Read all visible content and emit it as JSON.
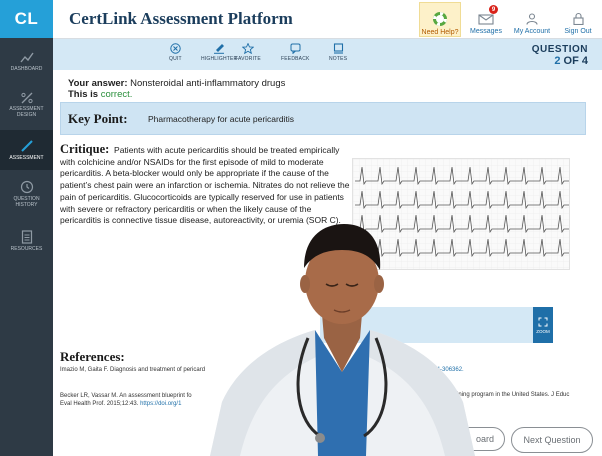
{
  "app": {
    "logo": "CL",
    "title": "CertLink Assessment Platform"
  },
  "header": {
    "help_label": "Need Help?",
    "messages_label": "Messages",
    "messages_count": "9",
    "account_label": "My Account",
    "signout_label": "Sign Out"
  },
  "sidebar": {
    "items": [
      {
        "label": "DASHBOARD",
        "icon": "line-chart-icon"
      },
      {
        "label": "ASSESSMENT DESIGN",
        "icon": "percent-icon"
      },
      {
        "label": "ASSESSMENT",
        "icon": "pencil-icon",
        "active": true
      },
      {
        "label": "QUESTION HISTORY",
        "icon": "history-icon"
      },
      {
        "label": "RESOURCES",
        "icon": "document-icon"
      }
    ]
  },
  "toolbar": {
    "items": [
      {
        "label": "QUIT",
        "icon": "close-circle-icon"
      },
      {
        "label": "HIGHLIGHTER",
        "icon": "highlighter-icon"
      },
      {
        "label": "FAVORITE",
        "icon": "star-icon"
      },
      {
        "label": "FEEDBACK",
        "icon": "chat-icon"
      },
      {
        "label": "NOTES",
        "icon": "notes-icon"
      }
    ],
    "question_word": "QUESTION",
    "question_current": "2",
    "question_of": "OF 4"
  },
  "answer": {
    "prefix": "Your answer:",
    "value": "Nonsteroidal anti-inflammatory drugs",
    "status_prefix": "This is",
    "status": "correct."
  },
  "keypoint": {
    "label": "Key Point:",
    "text": "Pharmacotherapy for acute pericarditis"
  },
  "critique": {
    "label": "Critique:",
    "text": "Patients with acute pericarditis should be treated empirically with colchicine and/or NSAIDs for the first episode of mild to moderate pericarditis. A beta-blocker would only be appropriate if the cause of the patient’s chest pain were an infarction or ischemia. Nitrates do not relieve the pain of pericarditis. Glucocorticoids are typically reserved for use in patients with severe or refractory pericarditis or when the likely cause of the pericarditis is connective tissue disease, autoreactivity, or uremia (SOR C)."
  },
  "zoom_label": "ZOOM",
  "references": {
    "title": "References:",
    "ref1_start": "Imazio M, Gaita F. Diagnosis and treatment of pericard",
    "ref1_end": "nl-2014-306362.",
    "ref2_start": "Becker LR, Vassar M. An assessment blueprint fo",
    "ref2_line2": "Eval Health Prof. 2015;12:43.",
    "ref2_link": "https://doi.org/1",
    "ref2_end": "training program in the United States. J Educ"
  },
  "buttons": {
    "prev": "oard",
    "next": "Next Question"
  },
  "colors": {
    "brand": "#25a0d8",
    "sidebar": "#2e3a45",
    "toolbar": "#d4e8f5",
    "keypoint": "#cfe4f3",
    "correct": "#2a8f3c"
  }
}
